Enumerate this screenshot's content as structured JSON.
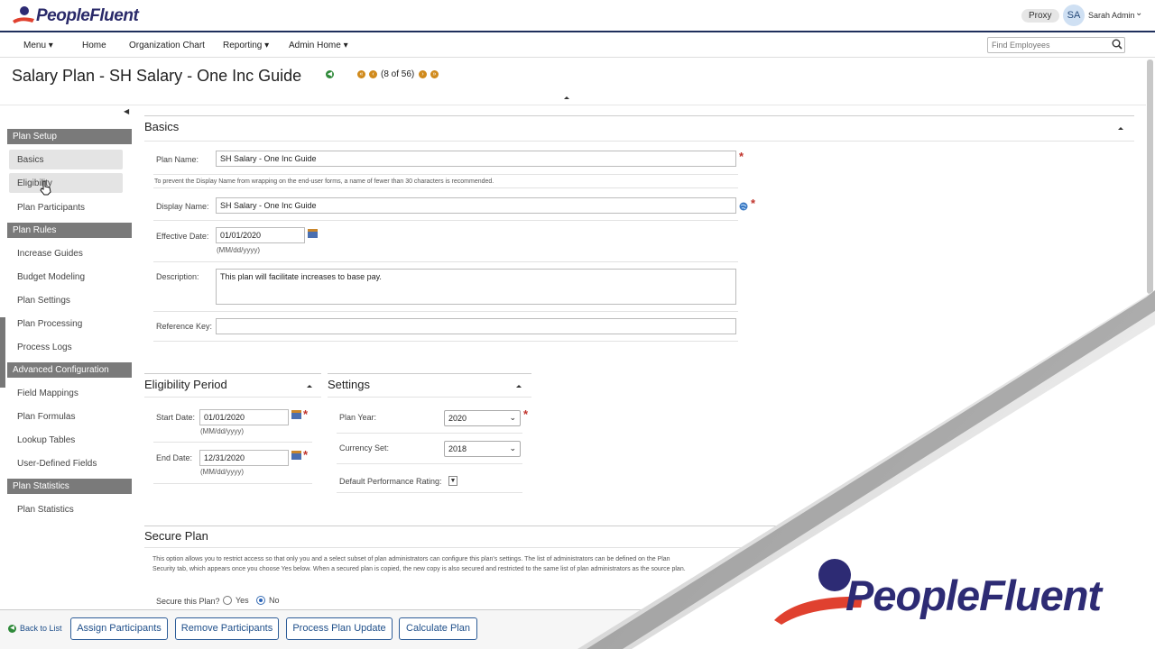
{
  "brand": {
    "name": "PeopleFluent",
    "accent": "#e0412f",
    "navy": "#2d2b74"
  },
  "header": {
    "proxy": "Proxy",
    "avatar_initials": "SA",
    "user_name": "Sarah Admin"
  },
  "nav": {
    "items": [
      "Menu ▾",
      "Home",
      "Organization Chart",
      "Reporting ▾",
      "Admin Home ▾"
    ],
    "search_placeholder": "Find Employees"
  },
  "title": {
    "text": "Salary Plan - SH Salary - One Inc Guide",
    "pager": "(8 of 56)"
  },
  "sidebar": {
    "groups": [
      {
        "heading": "Plan Setup",
        "items": [
          "Basics",
          "Eligibility",
          "Plan Participants"
        ]
      },
      {
        "heading": "Plan Rules",
        "items": [
          "Increase Guides",
          "Budget Modeling",
          "Plan Settings",
          "Plan Processing",
          "Process Logs"
        ]
      },
      {
        "heading": "Advanced Configuration",
        "items": [
          "Field Mappings",
          "Plan Formulas",
          "Lookup Tables",
          "User-Defined Fields"
        ]
      },
      {
        "heading": "Plan Statistics",
        "items": [
          "Plan Statistics"
        ]
      }
    ]
  },
  "basics": {
    "title": "Basics",
    "plan_name_label": "Plan Name:",
    "plan_name_value": "SH Salary - One Inc Guide",
    "plan_name_hint": "To prevent the Display Name from wrapping on the end-user forms, a name of fewer than 30 characters is recommended.",
    "display_name_label": "Display Name:",
    "display_name_value": "SH Salary - One Inc Guide",
    "effective_date_label": "Effective Date:",
    "effective_date_value": "01/01/2020",
    "date_format": "(MM/dd/yyyy)",
    "description_label": "Description:",
    "description_value": "This plan will facilitate increases to base pay.",
    "reference_key_label": "Reference Key:",
    "reference_key_value": ""
  },
  "eligibility": {
    "title": "Eligibility Period",
    "start_label": "Start Date:",
    "start_value": "01/01/2020",
    "end_label": "End Date:",
    "end_value": "12/31/2020",
    "date_format": "(MM/dd/yyyy)"
  },
  "settings": {
    "title": "Settings",
    "plan_year_label": "Plan Year:",
    "plan_year_value": "2020",
    "currency_label": "Currency Set:",
    "currency_value": "2018",
    "perf_label": "Default Performance Rating:"
  },
  "secure": {
    "title": "Secure Plan",
    "text": "This option allows you to restrict access so that only you and a select subset of plan administrators can configure this plan's settings. The list of administrators can be defined on the Plan Security tab, which appears once you choose Yes below. When a secured plan is copied, the new copy is also secured and restricted to the same list of plan administrators as the source plan.",
    "question": "Secure this Plan?",
    "yes": "Yes",
    "no": "No",
    "selected": "No"
  },
  "footer": {
    "back": "Back to List",
    "buttons": [
      "Assign Participants",
      "Remove Participants",
      "Process Plan Update",
      "Calculate Plan"
    ]
  }
}
